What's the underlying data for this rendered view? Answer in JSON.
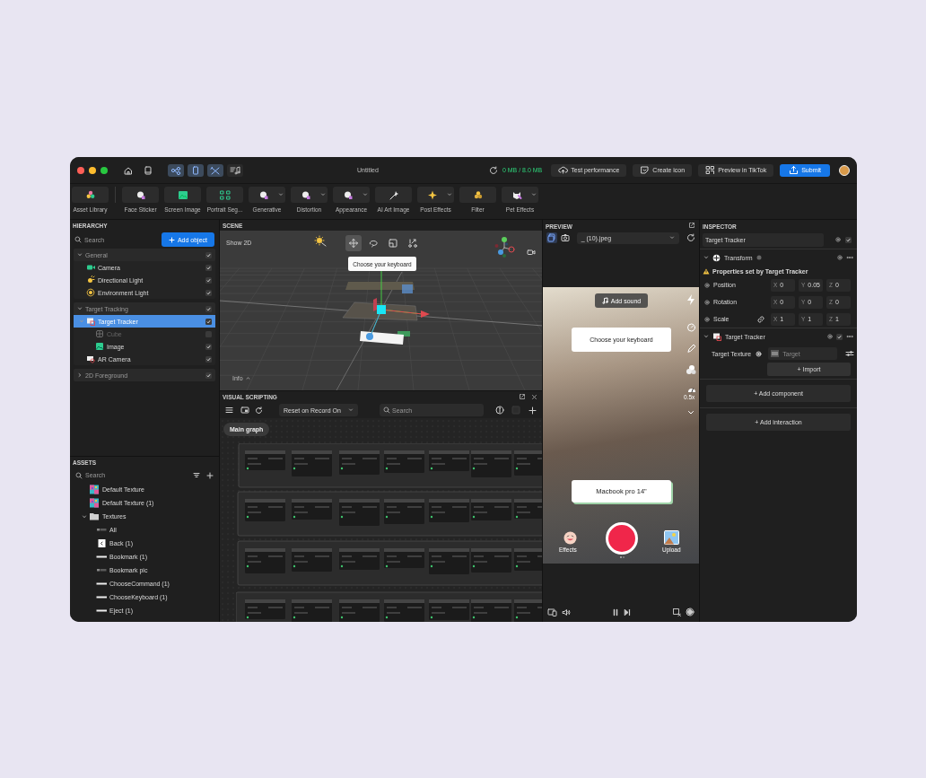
{
  "window": {
    "title": "Untitled",
    "memory": "0 MB / 8.0 MB"
  },
  "mode_buttons": [
    {
      "kind": "graph",
      "selected": true
    },
    {
      "kind": "phone",
      "selected": true
    },
    {
      "kind": "tools",
      "selected": true
    },
    {
      "kind": "music",
      "selected": false
    }
  ],
  "header_buttons": [
    {
      "label": "Test performance",
      "kind": "cloud",
      "primary": false
    },
    {
      "label": "Create icon",
      "kind": "sticker",
      "primary": false
    },
    {
      "label": "Preview in TikTok",
      "kind": "qr",
      "primary": false
    },
    {
      "label": "Submit",
      "kind": "upload",
      "primary": true
    }
  ],
  "toolbar": [
    {
      "label": "Asset Library",
      "kind": "assets",
      "dropdown": false
    },
    {
      "label": "Face Sticker",
      "kind": "face",
      "dropdown": false
    },
    {
      "label": "Screen Image",
      "kind": "image",
      "dropdown": false
    },
    {
      "label": "Portrait Seg...",
      "kind": "segment",
      "dropdown": false
    },
    {
      "label": "Generative",
      "kind": "face",
      "dropdown": true
    },
    {
      "label": "Distortion",
      "kind": "face",
      "dropdown": true
    },
    {
      "label": "Appearance",
      "kind": "face",
      "dropdown": true
    },
    {
      "label": "AI Art Image",
      "kind": "wand",
      "dropdown": false
    },
    {
      "label": "Post Effects",
      "kind": "sparkle",
      "dropdown": true
    },
    {
      "label": "Filter",
      "kind": "filter",
      "dropdown": false
    },
    {
      "label": "Pet Effects",
      "kind": "pet",
      "dropdown": true
    }
  ],
  "hierarchy": {
    "title": "HIERARCHY",
    "search": {
      "placeholder": "Search"
    },
    "add_button": "Add object",
    "groups": [
      {
        "label": "General",
        "expanded": true,
        "visible": true,
        "children": [
          {
            "label": "Camera",
            "kind": "camera",
            "visible": true,
            "selected": false
          },
          {
            "label": "Directional Light",
            "kind": "light",
            "visible": true,
            "selected": false
          },
          {
            "label": "Environment Light",
            "kind": "environment",
            "visible": true,
            "selected": false
          }
        ]
      },
      {
        "label": "Target Tracking",
        "expanded": true,
        "visible": true,
        "children": [
          {
            "label": "Target Tracker",
            "kind": "tracker",
            "visible": true,
            "selected": true,
            "expanded": true,
            "children": [
              {
                "label": "Cube",
                "kind": "cube",
                "visible": false,
                "selected": false
              },
              {
                "label": "Image",
                "kind": "image",
                "visible": true,
                "selected": false
              }
            ]
          },
          {
            "label": "AR Camera",
            "kind": "ar_camera",
            "visible": true,
            "selected": false
          }
        ]
      },
      {
        "label": "2D Foreground",
        "expanded": false,
        "visible": true
      }
    ]
  },
  "assets": {
    "title": "ASSETS",
    "search": {
      "placeholder": "Search"
    },
    "items": [
      {
        "label": "Default Texture",
        "kind": "texture"
      },
      {
        "label": "Default Texture (1)",
        "kind": "texture"
      },
      {
        "label": "Textures",
        "kind": "folder",
        "expanded": true,
        "children": [
          {
            "label": "All",
            "kind": "strip"
          },
          {
            "label": "Back (1)",
            "kind": "back"
          },
          {
            "label": "Bookmark (1)",
            "kind": "bar"
          },
          {
            "label": "Bookmark pic",
            "kind": "strip"
          },
          {
            "label": "ChooseCommand (1)",
            "kind": "bar"
          },
          {
            "label": "ChooseKeyboard (1)",
            "kind": "bar"
          },
          {
            "label": "Eject (1)",
            "kind": "bar"
          }
        ]
      }
    ]
  },
  "scene": {
    "title": "SCENE",
    "show_2d": "Show 2D",
    "info": "Info",
    "card_text": "Choose your keyboard",
    "tools": [
      {
        "kind": "move",
        "selected": true
      },
      {
        "kind": "rotate",
        "selected": false
      },
      {
        "kind": "scale",
        "selected": false
      },
      {
        "kind": "transform",
        "selected": false
      }
    ]
  },
  "visual_scripting": {
    "title": "VISUAL SCRIPTING",
    "dropdown": "Reset on Record On",
    "search": {
      "placeholder": "Search"
    },
    "graph_tab": "Main graph"
  },
  "preview": {
    "title": "PREVIEW",
    "views": [
      {
        "kind": "cube",
        "selected": true
      },
      {
        "kind": "camera",
        "selected": false
      }
    ],
    "file": "_ (10).jpeg",
    "add_sound": "Add sound",
    "cards": [
      "Choose your keyboard",
      "Macbook pro 14\""
    ],
    "speed": "0.5x",
    "effects": "Effects",
    "upload": "Upload"
  },
  "inspector": {
    "title": "INSPECTOR",
    "name": "Target Tracker",
    "enabled": true,
    "transform": {
      "title": "Transform",
      "expanded": true,
      "warning": "Properties set by Target Tracker",
      "rows": [
        {
          "label": "Position",
          "linked": false,
          "values": [
            {
              "axis": "X",
              "value": "0"
            },
            {
              "axis": "Y",
              "value": "0.05"
            },
            {
              "axis": "Z",
              "value": "0"
            }
          ]
        },
        {
          "label": "Rotation",
          "linked": false,
          "values": [
            {
              "axis": "X",
              "value": "0"
            },
            {
              "axis": "Y",
              "value": "0"
            },
            {
              "axis": "Z",
              "value": "0"
            }
          ]
        },
        {
          "label": "Scale",
          "linked": true,
          "values": [
            {
              "axis": "X",
              "value": "1"
            },
            {
              "axis": "Y",
              "value": "1"
            },
            {
              "axis": "Z",
              "value": "1"
            }
          ]
        }
      ]
    },
    "tracker": {
      "title": "Target Tracker",
      "expanded": true,
      "enabled": true,
      "texture_label": "Target Texture",
      "texture": "Target",
      "import_button": "+ Import"
    },
    "add_component": "+ Add component",
    "add_interaction": "+ Add interaction"
  }
}
